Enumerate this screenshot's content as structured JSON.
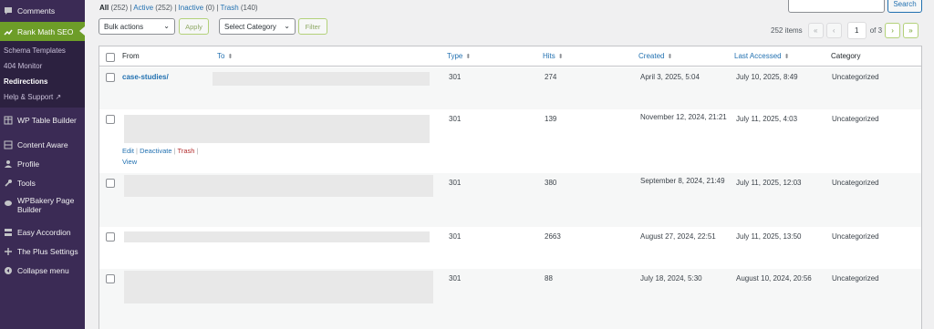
{
  "sidebar": {
    "items_top": [
      {
        "label": "Comments",
        "icon": "comments-icon"
      },
      {
        "label": "Rank Math SEO",
        "icon": "rank-math-icon",
        "active": true
      }
    ],
    "submenu": [
      {
        "label": "Schema Templates"
      },
      {
        "label": "404 Monitor"
      },
      {
        "label": "Redirections",
        "current": true
      },
      {
        "label": "Help & Support ↗"
      }
    ],
    "items_bottom": [
      {
        "label": "WP Table Builder",
        "icon": "table-icon"
      },
      {
        "label": "Content Aware",
        "icon": "grid-icon"
      },
      {
        "label": "Profile",
        "icon": "user-icon"
      },
      {
        "label": "Tools",
        "icon": "wrench-icon"
      },
      {
        "label": "WPBakery Page Builder",
        "icon": "wpbakery-icon"
      },
      {
        "label": "Easy Accordion",
        "icon": "accordion-icon"
      },
      {
        "label": "The Plus Settings",
        "icon": "plus-settings-icon"
      },
      {
        "label": "Collapse menu",
        "icon": "collapse-icon"
      }
    ]
  },
  "filters": {
    "all": "All",
    "all_count": "(252)",
    "active": "Active",
    "active_count": "(252)",
    "inactive": "Inactive",
    "inactive_count": "(0)",
    "trash": "Trash",
    "trash_count": "(140)",
    "sep": "|"
  },
  "search": {
    "button": "Search",
    "value": ""
  },
  "bulk": {
    "selected": "Bulk actions",
    "apply": "Apply"
  },
  "category": {
    "selected": "Select Category",
    "filter": "Filter"
  },
  "pagination": {
    "items": "252 items",
    "first": "«",
    "prev": "‹",
    "current": "1",
    "of": "of 3",
    "next": "›",
    "last": "»"
  },
  "table": {
    "headers": {
      "from": "From",
      "to": "To",
      "type": "Type",
      "hits": "Hits",
      "created": "Created",
      "last_accessed": "Last Accessed",
      "category": "Category"
    },
    "sort_icon": "sort-icon",
    "rows": [
      {
        "from": "case-studies/",
        "type": "301",
        "hits": "274",
        "created": "April 3, 2025, 5:04",
        "last_accessed": "July 10, 2025, 8:49",
        "category": "Uncategorized"
      },
      {
        "from": "",
        "type": "301",
        "hits": "139",
        "created": "November 12, 2024, 21:21",
        "last_accessed": "July 11, 2025, 4:03",
        "category": "Uncategorized",
        "actions": {
          "edit": "Edit",
          "deactivate": "Deactivate",
          "trash": "Trash",
          "view": "View",
          "sep": "|"
        }
      },
      {
        "from": "",
        "type": "301",
        "hits": "380",
        "created": "September 8, 2024, 21:49",
        "last_accessed": "July 11, 2025, 12:03",
        "category": "Uncategorized"
      },
      {
        "from": "",
        "type": "301",
        "hits": "2663",
        "created": "August 27, 2024, 22:51",
        "last_accessed": "July 11, 2025, 13:50",
        "category": "Uncategorized"
      },
      {
        "from": "",
        "type": "301",
        "hits": "88",
        "created": "July 18, 2024, 5:30",
        "last_accessed": "August 10, 2024, 20:56",
        "category": "Uncategorized"
      }
    ]
  },
  "colors": {
    "sidebar_bg": "#3b2b55",
    "active_menu": "#6d9d28",
    "link": "#2271b1",
    "trash": "#b32d2e"
  }
}
